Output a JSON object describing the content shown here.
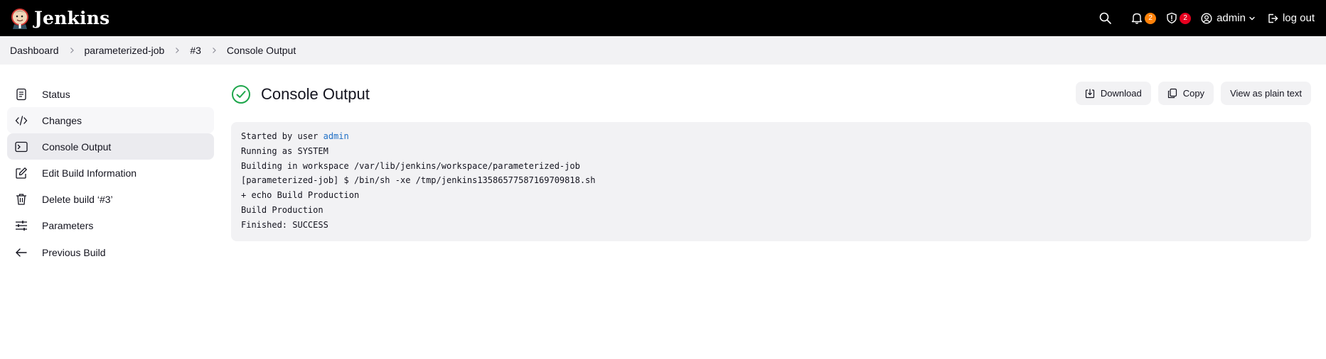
{
  "header": {
    "brand_name": "Jenkins",
    "brand_icon": "jenkins-butler-logo",
    "search_icon": "search-icon",
    "notifications_count": "2",
    "security_count": "2",
    "user_name": "admin",
    "logout_label": "log out",
    "colors": {
      "background": "#000000",
      "notification_badge": "#fe820a",
      "security_badge": "#e6001f"
    }
  },
  "breadcrumb": [
    "Dashboard",
    "parameterized-job",
    "#3",
    "Console Output"
  ],
  "sidebar": {
    "items": [
      {
        "label": "Status",
        "icon": "notepad-icon"
      },
      {
        "label": "Changes",
        "icon": "code-icon"
      },
      {
        "label": "Console Output",
        "icon": "terminal-icon",
        "active": true
      },
      {
        "label": "Edit Build Information",
        "icon": "edit-icon"
      },
      {
        "label": "Delete build ‘#3’",
        "icon": "trash-icon"
      },
      {
        "label": "Parameters",
        "icon": "sliders-icon"
      },
      {
        "label": "Previous Build",
        "icon": "arrow-left-icon"
      }
    ]
  },
  "main": {
    "title": "Console Output",
    "status_icon": "success-check-icon",
    "status_color": "#1ea64b",
    "actions": {
      "download": "Download",
      "copy": "Copy",
      "plain_text": "View as plain text"
    },
    "console": {
      "line1_prefix": "Started by user ",
      "line1_user": "admin",
      "lines": [
        "Running as SYSTEM",
        "Building in workspace /var/lib/jenkins/workspace/parameterized-job",
        "[parameterized-job] $ /bin/sh -xe /tmp/jenkins13586577587169709818.sh",
        "+ echo Build Production",
        "Build Production",
        "Finished: SUCCESS"
      ]
    }
  }
}
